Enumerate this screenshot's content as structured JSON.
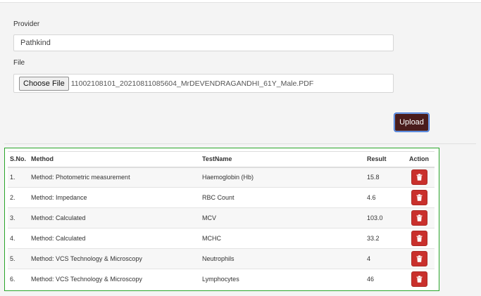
{
  "form": {
    "provider_label": "Provider",
    "provider_value": "Pathkind",
    "file_label": "File",
    "choose_file_label": "Choose File",
    "file_name": "11002108101_20210811085604_MrDEVENDRAGANDHI_61Y_Male.PDF",
    "upload_label": "Upload"
  },
  "table": {
    "headers": {
      "sno": "S.No.",
      "method": "Method",
      "testname": "TestName",
      "result": "Result",
      "action": "Action"
    },
    "rows": [
      {
        "sno": "1.",
        "method": "Method: Photometric measurement",
        "testname": "Haemoglobin (Hb)",
        "result": "15.8"
      },
      {
        "sno": "2.",
        "method": "Method: Impedance",
        "testname": "RBC Count",
        "result": "4.6"
      },
      {
        "sno": "3.",
        "method": "Method: Calculated",
        "testname": "MCV",
        "result": "103.0"
      },
      {
        "sno": "4.",
        "method": "Method: Calculated",
        "testname": "MCHC",
        "result": "33.2"
      },
      {
        "sno": "5.",
        "method": "Method: VCS Technology & Microscopy",
        "testname": "Neutrophils",
        "result": "4"
      },
      {
        "sno": "6.",
        "method": "Method: VCS Technology & Microscopy",
        "testname": "Lymphocytes",
        "result": "46"
      }
    ],
    "action_icon": "trash-icon"
  },
  "colors": {
    "upload_bg": "#4a1c1c",
    "delete_bg": "#c9302c",
    "table_border": "#2aa52a"
  }
}
